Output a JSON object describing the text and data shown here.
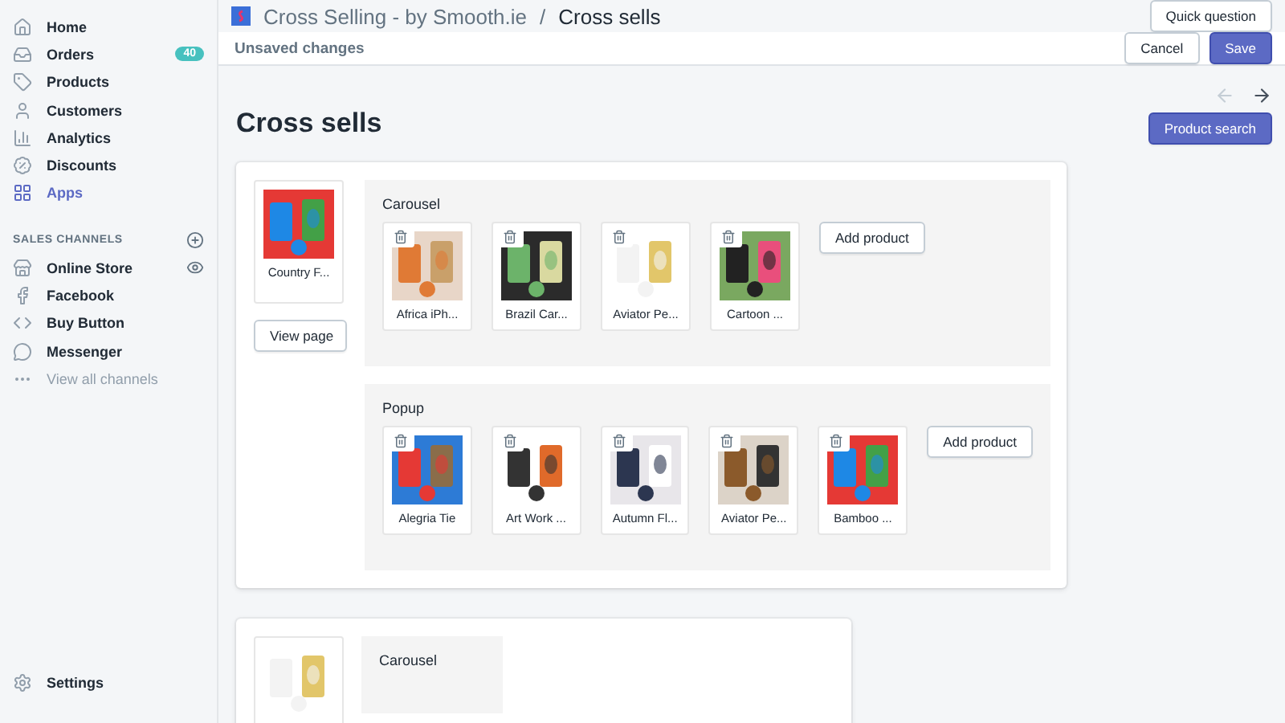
{
  "sidebar": {
    "items": [
      {
        "label": "Home",
        "selected": false
      },
      {
        "label": "Orders",
        "selected": false,
        "badge": "40"
      },
      {
        "label": "Products",
        "selected": false
      },
      {
        "label": "Customers",
        "selected": false
      },
      {
        "label": "Analytics",
        "selected": false
      },
      {
        "label": "Discounts",
        "selected": false
      },
      {
        "label": "Apps",
        "selected": true
      }
    ],
    "channels_heading": "SALES CHANNELS",
    "channels": [
      {
        "label": "Online Store"
      },
      {
        "label": "Facebook"
      },
      {
        "label": "Buy Button"
      },
      {
        "label": "Messenger"
      },
      {
        "label": "View all channels",
        "kind": "more"
      }
    ],
    "settings": "Settings"
  },
  "header": {
    "app": "Cross Selling - by Smooth.ie",
    "separator": "/",
    "page": "Cross sells",
    "button": "Quick question"
  },
  "save_bar": {
    "message": "Unsaved changes",
    "cancel": "Cancel",
    "save": "Save"
  },
  "page": {
    "title": "Cross sells",
    "nav": [
      {
        "kind": "back",
        "disabled": true
      },
      {
        "kind": "forward",
        "disabled": false
      }
    ],
    "search_button": "Product search"
  },
  "cross_sells": [
    {
      "product": {
        "name": "Country F..."
      },
      "view_button": "View page",
      "groups": [
        {
          "title": "Carousel",
          "products": [
            "Africa iPh...",
            "Brazil Car...",
            "Aviator Pe...",
            "Cartoon ..."
          ],
          "add_button": "Add product"
        },
        {
          "title": "Popup",
          "products": [
            "Alegria Tie",
            "Art Work ...",
            "Autumn Fl...",
            "Aviator Pe...",
            "Bamboo ..."
          ],
          "add_button": "Add product"
        }
      ]
    },
    {
      "product": {
        "kind": "picture"
      },
      "groups": [
        {
          "title": "Carousel"
        }
      ]
    }
  ]
}
